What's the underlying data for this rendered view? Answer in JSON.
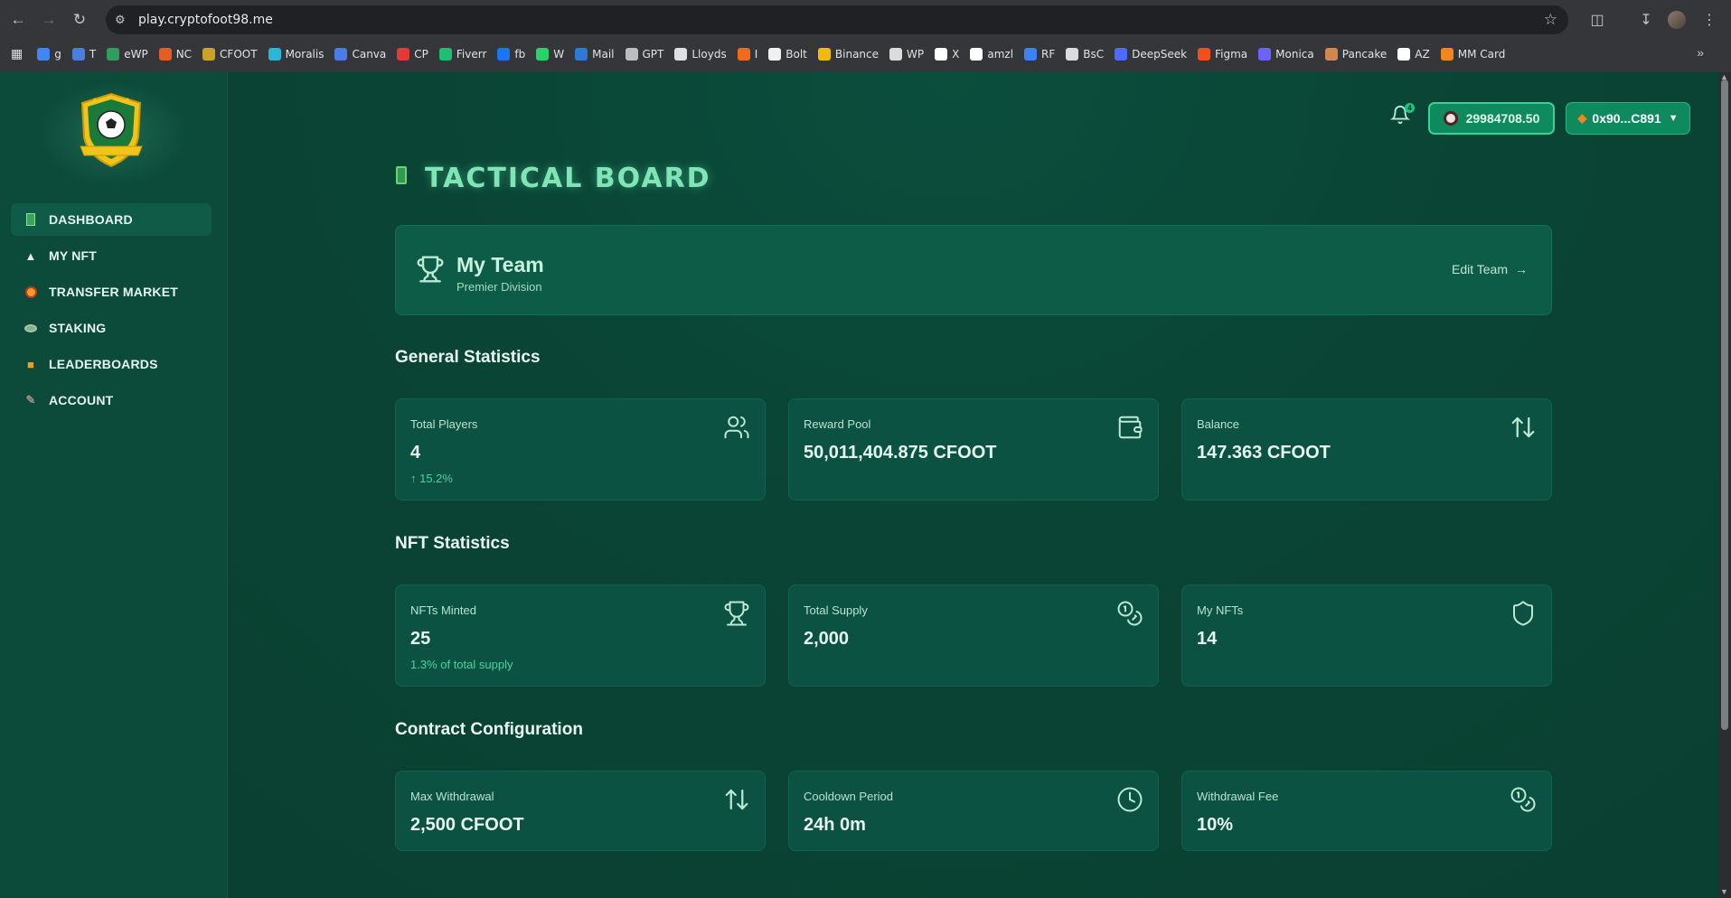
{
  "browser": {
    "url": "play.cryptofoot98.me",
    "bookmarks": [
      {
        "label": "g",
        "color": "#4285f4"
      },
      {
        "label": "T",
        "color": "#4a7fe0"
      },
      {
        "label": "eWP",
        "color": "#2e9d5e"
      },
      {
        "label": "NC",
        "color": "#e35d25"
      },
      {
        "label": "CFOOT",
        "color": "#c9a227"
      },
      {
        "label": "Moralis",
        "color": "#2bb5d6"
      },
      {
        "label": "Canva",
        "color": "#4b7de8"
      },
      {
        "label": "CP",
        "color": "#e53935"
      },
      {
        "label": "Fiverr",
        "color": "#1dbf73"
      },
      {
        "label": "fb",
        "color": "#1877f2"
      },
      {
        "label": "W",
        "color": "#25d366"
      },
      {
        "label": "Mail",
        "color": "#2c7ad6"
      },
      {
        "label": "GPT",
        "color": "#bdbdbd"
      },
      {
        "label": "Lloyds",
        "color": "#e0e0e0"
      },
      {
        "label": "I",
        "color": "#f26b1d"
      },
      {
        "label": "Bolt",
        "color": "#f0f0f0"
      },
      {
        "label": "Binance",
        "color": "#f0b90b"
      },
      {
        "label": "WP",
        "color": "#dcdcdc"
      },
      {
        "label": "X",
        "color": "#ffffff"
      },
      {
        "label": "amzl",
        "color": "#ffffff"
      },
      {
        "label": "RF",
        "color": "#3b82f6"
      },
      {
        "label": "BsC",
        "color": "#dcdcdc"
      },
      {
        "label": "DeepSeek",
        "color": "#4d6bfe"
      },
      {
        "label": "Figma",
        "color": "#f24e1e"
      },
      {
        "label": "Monica",
        "color": "#6c63ff"
      },
      {
        "label": "Pancake",
        "color": "#d1884f"
      },
      {
        "label": "AZ",
        "color": "#ffffff"
      },
      {
        "label": "MM Card",
        "color": "#f6851b"
      }
    ]
  },
  "sidebar": {
    "items": [
      {
        "label": "DASHBOARD",
        "icon": "pitch-icon"
      },
      {
        "label": "MY NFT",
        "icon": "shirt-icon"
      },
      {
        "label": "TRANSFER MARKET",
        "icon": "ball-icon"
      },
      {
        "label": "STAKING",
        "icon": "stadium-icon"
      },
      {
        "label": "LEADERBOARDS",
        "icon": "podium-icon"
      },
      {
        "label": "ACCOUNT",
        "icon": "boot-icon"
      }
    ]
  },
  "header": {
    "notifications": "4",
    "balance": "29984708.50",
    "wallet": "0x90...C891"
  },
  "page": {
    "title": "TACTICAL BOARD"
  },
  "team": {
    "name": "My Team",
    "division": "Premier Division",
    "edit_label": "Edit Team"
  },
  "general": {
    "title": "General Statistics",
    "cards": [
      {
        "label": "Total Players",
        "value": "4",
        "sub": "↑ 15.2%",
        "icon": "users-icon"
      },
      {
        "label": "Reward Pool",
        "value": "50,011,404.875 CFOOT",
        "sub": "",
        "icon": "wallet-icon"
      },
      {
        "label": "Balance",
        "value": "147.363 CFOOT",
        "sub": "",
        "icon": "arrows-up-down-icon"
      }
    ]
  },
  "nft": {
    "title": "NFT Statistics",
    "cards": [
      {
        "label": "NFTs Minted",
        "value": "25",
        "sub": "1.3% of total supply",
        "icon": "trophy-icon"
      },
      {
        "label": "Total Supply",
        "value": "2,000",
        "sub": "",
        "icon": "coins-icon"
      },
      {
        "label": "My NFTs",
        "value": "14",
        "sub": "",
        "icon": "shield-icon"
      }
    ]
  },
  "contract": {
    "title": "Contract Configuration",
    "cards": [
      {
        "label": "Max Withdrawal",
        "value": "2,500 CFOOT",
        "sub": "",
        "icon": "arrows-up-down-icon"
      },
      {
        "label": "Cooldown Period",
        "value": "24h 0m",
        "sub": "",
        "icon": "clock-icon"
      },
      {
        "label": "Withdrawal Fee",
        "value": "10%",
        "sub": "",
        "icon": "coins-icon"
      }
    ]
  }
}
